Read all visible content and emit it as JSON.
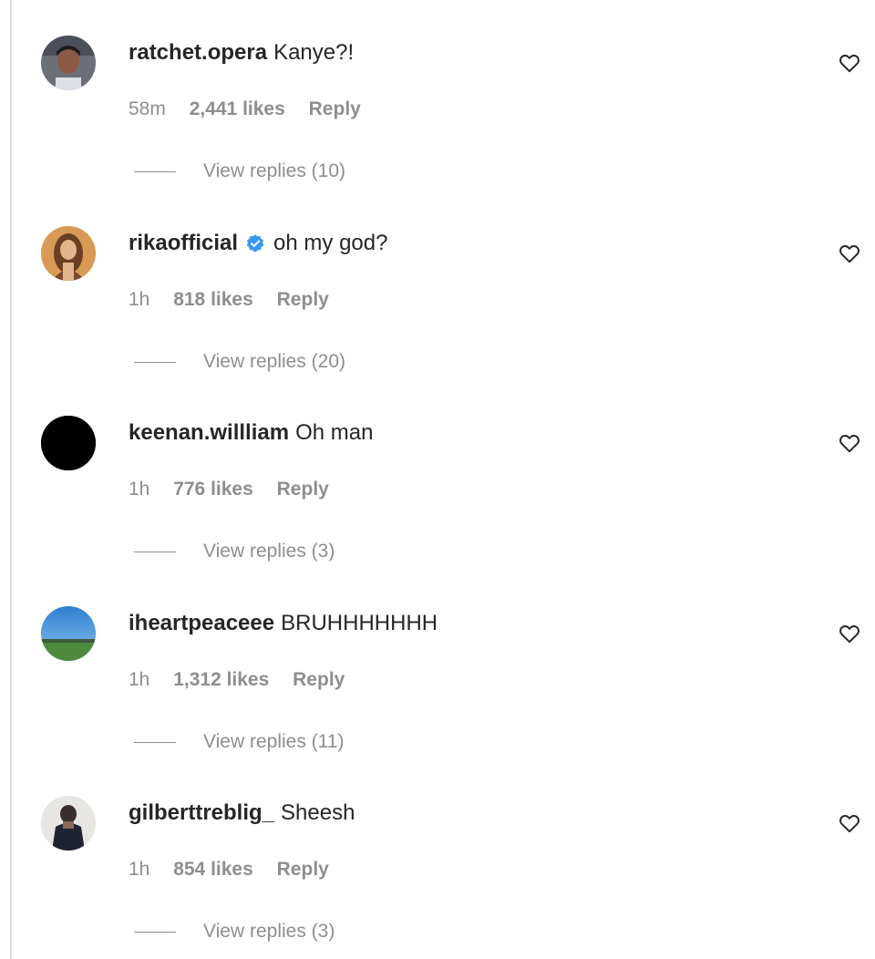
{
  "comments": [
    {
      "username": "ratchet.opera",
      "verified": false,
      "text": "Kanye?!",
      "time": "58m",
      "likes": "2,441 likes",
      "reply": "Reply",
      "view_replies": "View replies (10)",
      "avatar_icon": "person-photo-avatar"
    },
    {
      "username": "rikaofficial",
      "verified": true,
      "text": "oh my god?",
      "time": "1h",
      "likes": "818 likes",
      "reply": "Reply",
      "view_replies": "View replies (20)",
      "avatar_icon": "person-photo-avatar"
    },
    {
      "username": "keenan.willliam",
      "verified": false,
      "text": "Oh man",
      "time": "1h",
      "likes": "776 likes",
      "reply": "Reply",
      "view_replies": "View replies (3)",
      "avatar_icon": "black-avatar"
    },
    {
      "username": "iheartpeaceee",
      "verified": false,
      "text": "BRUHHHHHHH",
      "time": "1h",
      "likes": "1,312 likes",
      "reply": "Reply",
      "view_replies": "View replies (11)",
      "avatar_icon": "landscape-photo-avatar"
    },
    {
      "username": "gilberttreblig_",
      "verified": false,
      "text": "Sheesh",
      "time": "1h",
      "likes": "854 likes",
      "reply": "Reply",
      "view_replies": "View replies (3)",
      "avatar_icon": "person-photo-avatar"
    }
  ],
  "colors": {
    "text_primary": "#262626",
    "text_secondary": "#8e8e8e",
    "verified_blue": "#3897f0",
    "background": "#ffffff"
  },
  "icons": {
    "like": "heart-outline-icon",
    "verified": "verified-badge-icon"
  }
}
